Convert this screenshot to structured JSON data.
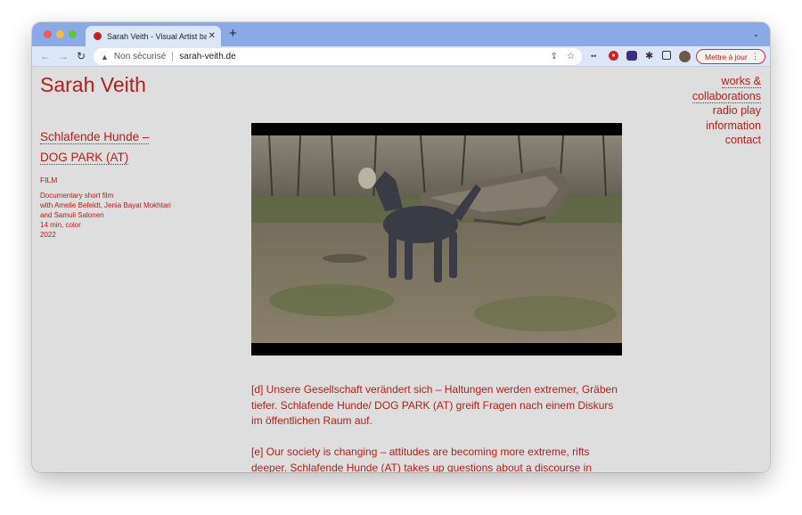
{
  "browser": {
    "tab_title": "Sarah Veith - Visual Artist based",
    "tab_close": "✕",
    "new_tab": "+",
    "tab_menu": "⌄",
    "security_label": "Non sécurisé",
    "url": "sarah-veith.de",
    "update_label": "Mettre à jour",
    "colors": {
      "tabstrip": "#8aa9e6",
      "toolbar": "#dce6f9",
      "accent": "#b3261e"
    }
  },
  "site": {
    "title": "Sarah Veith",
    "nav": [
      {
        "label": "works &"
      },
      {
        "label": "collaborations"
      },
      {
        "label": "radio play"
      },
      {
        "label": "information"
      },
      {
        "label": "contact"
      }
    ]
  },
  "work": {
    "title_line1": "Schlafende Hunde –",
    "title_line2": "DOG PARK (AT)",
    "category": "FILM",
    "meta": [
      "Documentary short film",
      "with Amelie Befeldt, Jenia Bayat Mokhtari",
      "and Samuli Salonen",
      "14 min, color",
      "2022"
    ],
    "text_de": "[d] Unsere Gesellschaft verändert sich – Haltungen werden extremer, Gräben tiefer. Schlafende Hunde/ DOG PARK (AT) greift Fragen nach einem Diskurs im öffentlichen Raum auf.",
    "text_en": "[e] Our society is changing – attitudes are becoming more extreme, rifts deeper. Schlafende Hunde (AT) takes up questions about a discourse in"
  },
  "colors": {
    "page_bg": "#dedede",
    "text": "#b3201a"
  }
}
